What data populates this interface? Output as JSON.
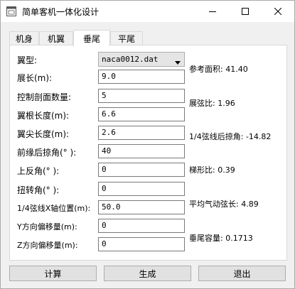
{
  "window": {
    "title": "简单客机一体化设计"
  },
  "tabs": [
    {
      "label": "机身",
      "active": false
    },
    {
      "label": "机翼",
      "active": false
    },
    {
      "label": "垂尾",
      "active": true
    },
    {
      "label": "平尾",
      "active": false
    }
  ],
  "form": {
    "airfoil_label": "翼型:",
    "airfoil_value": "naca0012.dat",
    "span_label": "展长(m):",
    "span_value": "9.0",
    "sections_label": "控制剖面数量:",
    "sections_value": "5",
    "root_chord_label": "翼根长度(m):",
    "root_chord_value": "6.6",
    "tip_chord_label": "翼尖长度(m):",
    "tip_chord_value": "2.6",
    "le_sweep_label": "前缘后掠角(° ):",
    "le_sweep_value": "40",
    "dihedral_label": "上反角(° ):",
    "dihedral_value": "0",
    "twist_label": "扭转角(° ):",
    "twist_value": "0",
    "quarter_x_label": "1/4弦线X轴位置(m):",
    "quarter_x_value": "50.0",
    "y_offset_label": "Y方向偏移量(m):",
    "y_offset_value": "0",
    "z_offset_label": "Z方向偏移量(m):",
    "z_offset_value": "0"
  },
  "results": {
    "ref_area": "参考面积: 41.40",
    "aspect_ratio": "展弦比: 1.96",
    "quarter_sweep": "1/4弦线后掠角: -14.82",
    "taper_ratio": "梯形比: 0.39",
    "mac": "平均气动弦长: 4.89",
    "tail_volume": "垂尾容量: 0.1713"
  },
  "buttons": {
    "calculate": "计算",
    "generate": "生成",
    "exit": "退出"
  },
  "icons": {
    "app": "app-window-icon",
    "minimize": "minimize-icon",
    "maximize": "maximize-icon",
    "close": "close-icon",
    "dropdown": "chevron-down-icon"
  }
}
